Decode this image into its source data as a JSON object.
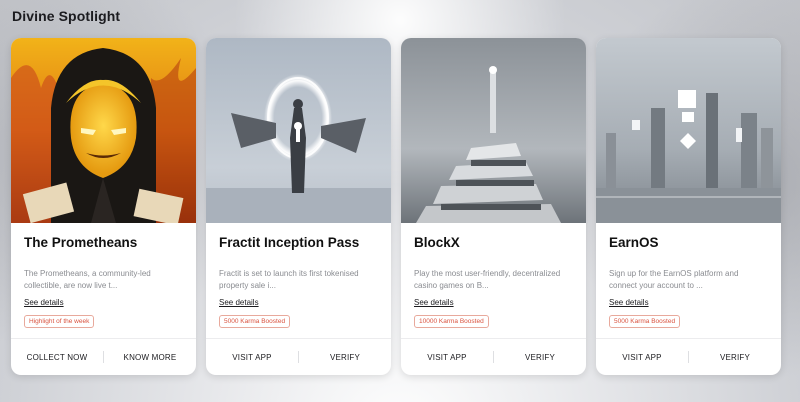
{
  "section": {
    "title": "Divine Spotlight"
  },
  "cards": [
    {
      "title": "The Prometheans",
      "description": "The Prometheans, a community-led collectible, are now live t...",
      "see_details": "See details",
      "badge": "Highlight of the week",
      "actions": [
        "COLLECT NOW",
        "KNOW MORE"
      ]
    },
    {
      "title": "Fractit Inception Pass",
      "description": "Fractit is set to launch its first tokenised property sale i...",
      "see_details": "See details",
      "badge": "5000 Karma Boosted",
      "actions": [
        "VISIT APP",
        "VERIFY"
      ]
    },
    {
      "title": "BlockX",
      "description": "Play the most user-friendly, decentralized casino games on B...",
      "see_details": "See details",
      "badge": "10000 Karma Boosted",
      "actions": [
        "VISIT APP",
        "VERIFY"
      ]
    },
    {
      "title": "EarnOS",
      "description": "Sign up for the EarnOS platform and connect your account to ...",
      "see_details": "See details",
      "badge": "5000 Karma Boosted",
      "actions": [
        "VISIT APP",
        "VERIFY"
      ]
    }
  ],
  "colors": {
    "badge_text": "#d9533f",
    "badge_border": "#e8a99c",
    "title": "#111111",
    "description": "#8a8c91"
  },
  "icons": [
    "promethean-artwork",
    "portal-figure-artwork",
    "floating-path-artwork",
    "monolith-city-artwork"
  ]
}
